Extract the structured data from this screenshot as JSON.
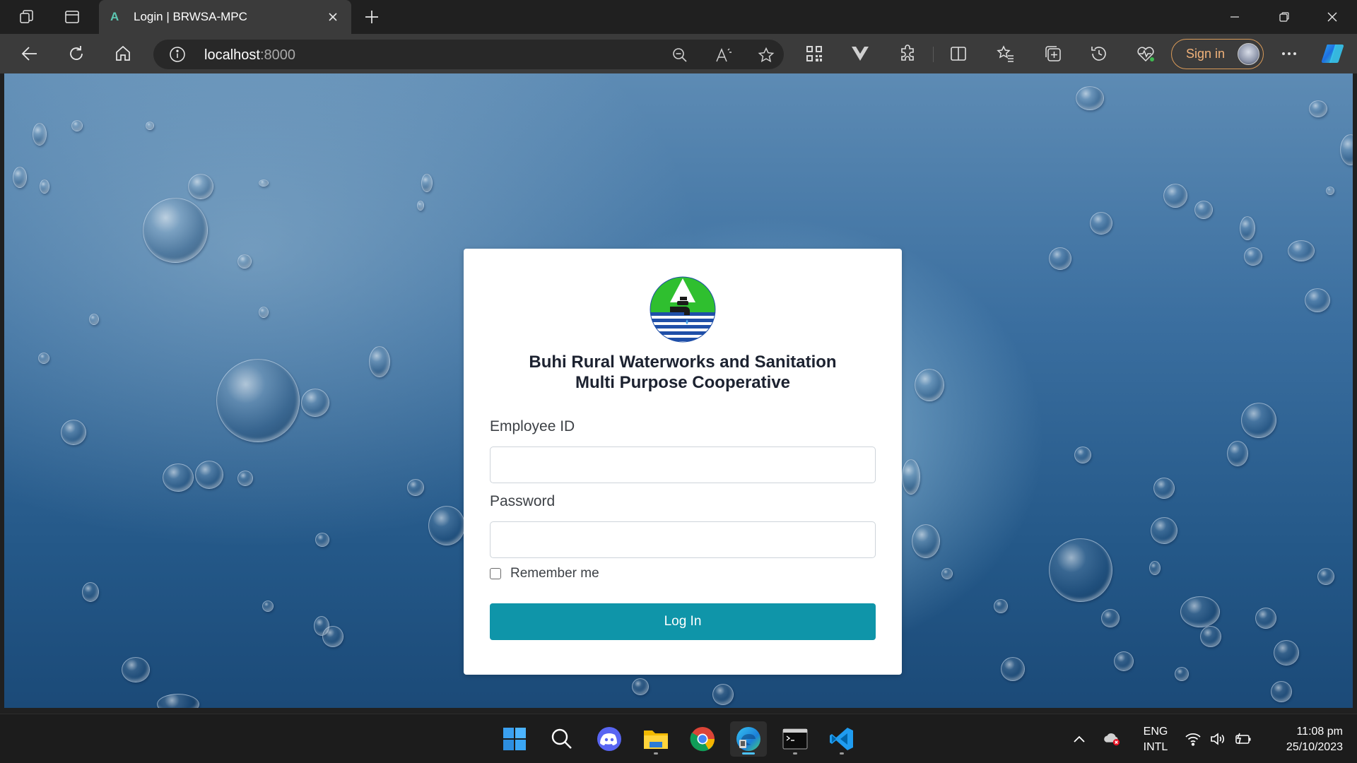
{
  "browser": {
    "tab": {
      "title": "Login | BRWSA-MPC",
      "favicon": "A"
    },
    "address": {
      "host": "localhost",
      "port": ":8000"
    },
    "signin_label": "Sign in"
  },
  "login": {
    "org_name_line1": "Buhi Rural Waterworks and Sanitation",
    "org_name_line2": "Multi Purpose Cooperative",
    "employee_id_label": "Employee ID",
    "employee_id_value": "",
    "password_label": "Password",
    "password_value": "",
    "remember_label": "Remember me",
    "remember_checked": false,
    "login_button": "Log In"
  },
  "taskbar": {
    "lang_line1": "ENG",
    "lang_line2": "INTL",
    "time": "11:08 pm",
    "date": "25/10/2023"
  },
  "colors": {
    "accent_button": "#0f95a9",
    "signin_border": "#d99a58",
    "logo_green": "#2fbf2f",
    "logo_blue": "#1f4fa8"
  }
}
